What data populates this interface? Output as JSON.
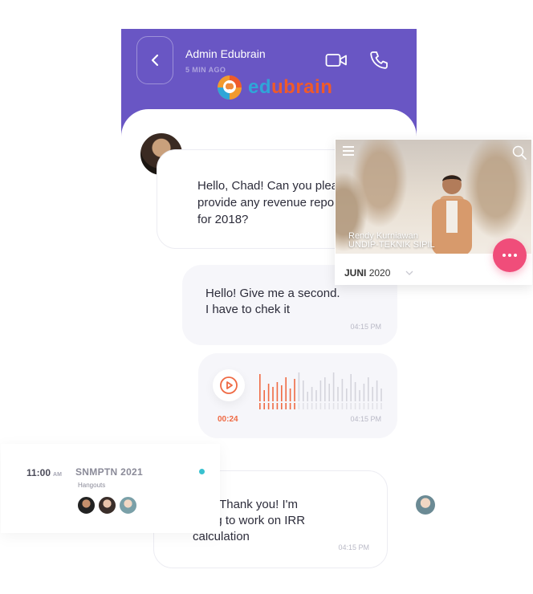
{
  "header": {
    "name": "Admin Edubrain",
    "last_seen": "5 MIN AGO",
    "logo_text": "edubrain",
    "logo_prefix": "ed",
    "logo_suffix": "ubrain"
  },
  "messages": [
    {
      "text": "Hello, Chad! Can you please\nprovide any revenue report\nfor 2018?"
    },
    {
      "text": "Hello! Give me a second.\nI have to chek it",
      "time": "04:15 PM"
    },
    {
      "duration": "00:24",
      "time": "04:15 PM"
    },
    {
      "text": "...at! Thank you! I'm\ngoing to work on IRR\ncalculation",
      "time": "04:15 PM"
    }
  ],
  "video_card": {
    "name": "Rendy Kurniawan",
    "school": "UNDIP-TEKNIK SIPIL",
    "month": "JUNI",
    "year": "2020"
  },
  "event_card": {
    "time": "11:00",
    "ampm": "AM",
    "title": "SNMPTN 2021",
    "subtitle": "Hangouts"
  },
  "colors": {
    "header_bg": "#6956c4",
    "accent_orange": "#ef6a44",
    "dots_button": "#f04d7a",
    "event_dot": "#38c1cf"
  },
  "icons": [
    "chevron-left-icon",
    "video-call-icon",
    "phone-icon",
    "play-icon",
    "menu-icon",
    "search-icon",
    "more-dots-icon"
  ]
}
